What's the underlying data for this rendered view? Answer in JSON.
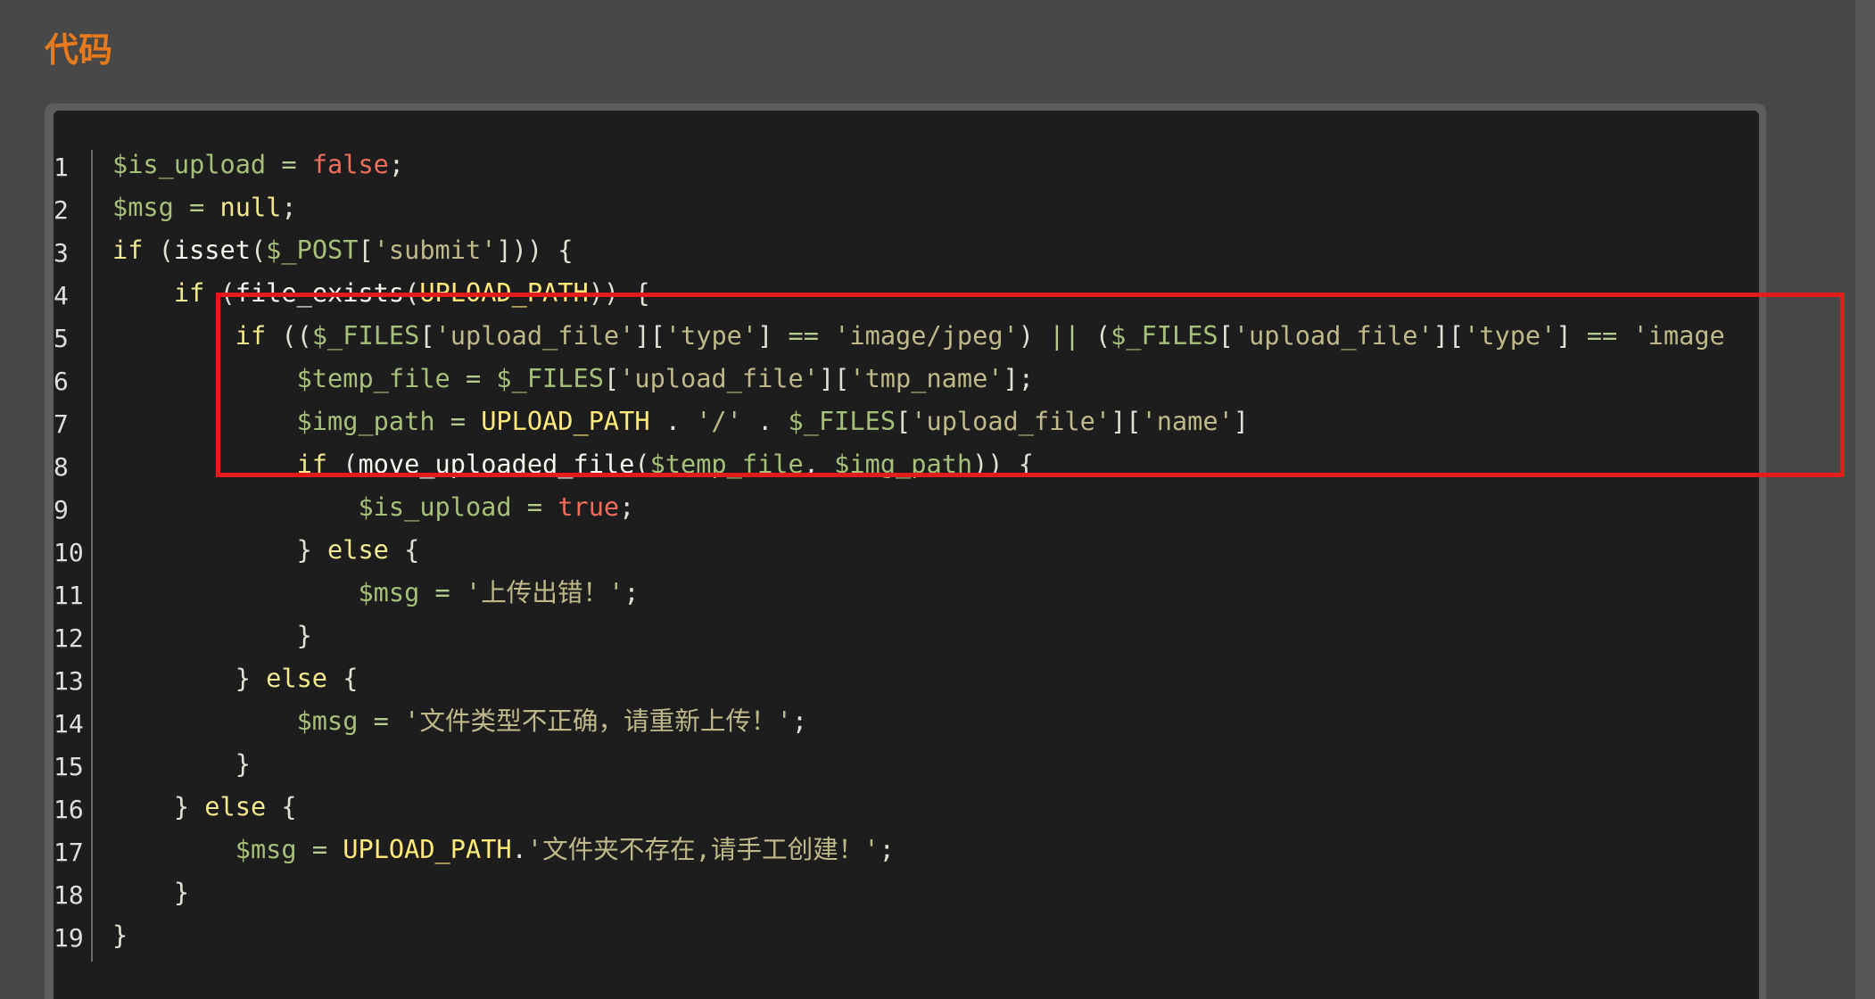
{
  "section": {
    "title": "代码"
  },
  "code": {
    "line_numbers": [
      "1",
      "2",
      "3",
      "4",
      "5",
      "6",
      "7",
      "8",
      "9",
      "10",
      "11",
      "12",
      "13",
      "14",
      "15",
      "16",
      "17",
      "18",
      "19"
    ],
    "lines": [
      [
        {
          "t": "$is_upload",
          "c": "var"
        },
        {
          "t": " = ",
          "c": "op"
        },
        {
          "t": "false",
          "c": "bool"
        },
        {
          "t": ";",
          "c": "pl"
        }
      ],
      [
        {
          "t": "$msg",
          "c": "var"
        },
        {
          "t": " = ",
          "c": "op"
        },
        {
          "t": "null",
          "c": "kw"
        },
        {
          "t": ";",
          "c": "pl"
        }
      ],
      [
        {
          "t": "if",
          "c": "kw"
        },
        {
          "t": " (",
          "c": "pl"
        },
        {
          "t": "isset",
          "c": "fn"
        },
        {
          "t": "(",
          "c": "pl"
        },
        {
          "t": "$_POST",
          "c": "var"
        },
        {
          "t": "[",
          "c": "pl"
        },
        {
          "t": "'submit'",
          "c": "str"
        },
        {
          "t": "])) {",
          "c": "pl"
        }
      ],
      [
        {
          "t": "    ",
          "c": "pl"
        },
        {
          "t": "if",
          "c": "kw"
        },
        {
          "t": " (",
          "c": "pl"
        },
        {
          "t": "file_exists",
          "c": "fn"
        },
        {
          "t": "(",
          "c": "pl"
        },
        {
          "t": "UPLOAD_PATH",
          "c": "const"
        },
        {
          "t": ")) {",
          "c": "pl"
        }
      ],
      [
        {
          "t": "        ",
          "c": "pl"
        },
        {
          "t": "if",
          "c": "kw"
        },
        {
          "t": " ((",
          "c": "pl"
        },
        {
          "t": "$_FILES",
          "c": "var"
        },
        {
          "t": "[",
          "c": "pl"
        },
        {
          "t": "'upload_file'",
          "c": "str"
        },
        {
          "t": "][",
          "c": "pl"
        },
        {
          "t": "'type'",
          "c": "str"
        },
        {
          "t": "] ",
          "c": "pl"
        },
        {
          "t": "==",
          "c": "op"
        },
        {
          "t": " ",
          "c": "pl"
        },
        {
          "t": "'image/jpeg'",
          "c": "str"
        },
        {
          "t": ") ",
          "c": "pl"
        },
        {
          "t": "||",
          "c": "op"
        },
        {
          "t": " (",
          "c": "pl"
        },
        {
          "t": "$_FILES",
          "c": "var"
        },
        {
          "t": "[",
          "c": "pl"
        },
        {
          "t": "'upload_file'",
          "c": "str"
        },
        {
          "t": "][",
          "c": "pl"
        },
        {
          "t": "'type'",
          "c": "str"
        },
        {
          "t": "] ",
          "c": "pl"
        },
        {
          "t": "==",
          "c": "op"
        },
        {
          "t": " ",
          "c": "pl"
        },
        {
          "t": "'image",
          "c": "str"
        }
      ],
      [
        {
          "t": "            ",
          "c": "pl"
        },
        {
          "t": "$temp_file",
          "c": "var"
        },
        {
          "t": " = ",
          "c": "op"
        },
        {
          "t": "$_FILES",
          "c": "var"
        },
        {
          "t": "[",
          "c": "pl"
        },
        {
          "t": "'upload_file'",
          "c": "str"
        },
        {
          "t": "][",
          "c": "pl"
        },
        {
          "t": "'tmp_name'",
          "c": "str"
        },
        {
          "t": "];",
          "c": "pl"
        }
      ],
      [
        {
          "t": "            ",
          "c": "pl"
        },
        {
          "t": "$img_path",
          "c": "var"
        },
        {
          "t": " = ",
          "c": "op"
        },
        {
          "t": "UPLOAD_PATH",
          "c": "const"
        },
        {
          "t": " . ",
          "c": "pl"
        },
        {
          "t": "'/'",
          "c": "str"
        },
        {
          "t": " . ",
          "c": "pl"
        },
        {
          "t": "$_FILES",
          "c": "var"
        },
        {
          "t": "[",
          "c": "pl"
        },
        {
          "t": "'upload_file'",
          "c": "str"
        },
        {
          "t": "][",
          "c": "pl"
        },
        {
          "t": "'name'",
          "c": "str"
        },
        {
          "t": "]",
          "c": "pl"
        }
      ],
      [
        {
          "t": "            ",
          "c": "pl"
        },
        {
          "t": "if",
          "c": "kw"
        },
        {
          "t": " (",
          "c": "pl"
        },
        {
          "t": "move_uploaded_file",
          "c": "fn"
        },
        {
          "t": "(",
          "c": "pl"
        },
        {
          "t": "$temp_file",
          "c": "var"
        },
        {
          "t": ", ",
          "c": "pl"
        },
        {
          "t": "$img_path",
          "c": "var"
        },
        {
          "t": ")) {",
          "c": "pl"
        }
      ],
      [
        {
          "t": "                ",
          "c": "pl"
        },
        {
          "t": "$is_upload",
          "c": "var"
        },
        {
          "t": " = ",
          "c": "op"
        },
        {
          "t": "true",
          "c": "bool"
        },
        {
          "t": ";",
          "c": "pl"
        }
      ],
      [
        {
          "t": "            } ",
          "c": "pl"
        },
        {
          "t": "else",
          "c": "kw"
        },
        {
          "t": " {",
          "c": "pl"
        }
      ],
      [
        {
          "t": "                ",
          "c": "pl"
        },
        {
          "t": "$msg",
          "c": "var"
        },
        {
          "t": " = ",
          "c": "op"
        },
        {
          "t": "'上传出错！'",
          "c": "str"
        },
        {
          "t": ";",
          "c": "pl"
        }
      ],
      [
        {
          "t": "            }",
          "c": "pl"
        }
      ],
      [
        {
          "t": "        } ",
          "c": "pl"
        },
        {
          "t": "else",
          "c": "kw"
        },
        {
          "t": " {",
          "c": "pl"
        }
      ],
      [
        {
          "t": "            ",
          "c": "pl"
        },
        {
          "t": "$msg",
          "c": "var"
        },
        {
          "t": " = ",
          "c": "op"
        },
        {
          "t": "'文件类型不正确，请重新上传！'",
          "c": "str"
        },
        {
          "t": ";",
          "c": "pl"
        }
      ],
      [
        {
          "t": "        }",
          "c": "pl"
        }
      ],
      [
        {
          "t": "    } ",
          "c": "pl"
        },
        {
          "t": "else",
          "c": "kw"
        },
        {
          "t": " {",
          "c": "pl"
        }
      ],
      [
        {
          "t": "        ",
          "c": "pl"
        },
        {
          "t": "$msg",
          "c": "var"
        },
        {
          "t": " = ",
          "c": "op"
        },
        {
          "t": "UPLOAD_PATH",
          "c": "const"
        },
        {
          "t": ".",
          "c": "pl"
        },
        {
          "t": "'文件夹不存在,请手工创建！'",
          "c": "str"
        },
        {
          "t": ";",
          "c": "pl"
        }
      ],
      [
        {
          "t": "    }",
          "c": "pl"
        }
      ],
      [
        {
          "t": "}",
          "c": "pl"
        }
      ]
    ]
  },
  "colors": {
    "title": "#e87a1c",
    "highlight_border": "#e21b1b",
    "panel_background": "#1d1d1d",
    "page_background": "#484848"
  }
}
